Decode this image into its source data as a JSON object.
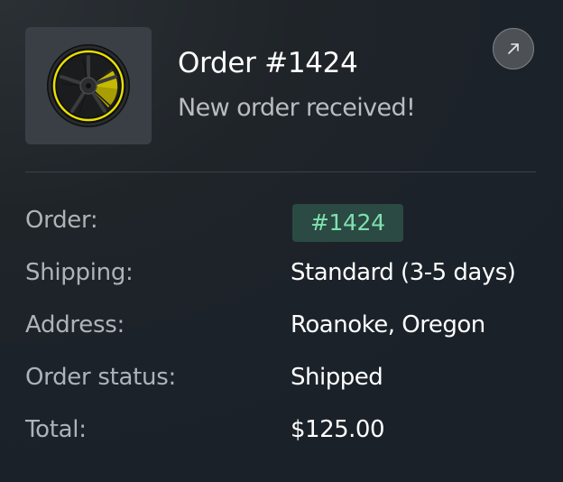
{
  "order": {
    "title": "Order #1424",
    "subtitle": "New order received!",
    "thumbnail_icon": "wheel-icon",
    "open_icon": "arrow-up-right-icon"
  },
  "details": {
    "order_label": "Order:",
    "order_value": "#1424",
    "shipping_label": "Shipping:",
    "shipping_value": "Standard (3-5 days)",
    "address_label": "Address:",
    "address_value": "Roanoke, Oregon",
    "status_label": "Order status:",
    "status_value": "Shipped",
    "total_label": "Total:",
    "total_value": "$125.00"
  },
  "colors": {
    "badge_background": "#2b4a43",
    "badge_text": "#7fe0b0",
    "wheel_accent": "#e8e000"
  }
}
